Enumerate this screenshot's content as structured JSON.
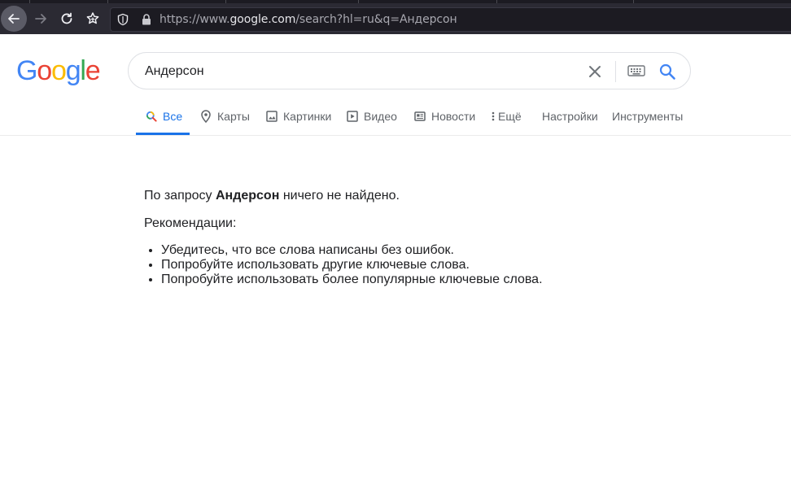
{
  "browser": {
    "url_prefix": "https://www.",
    "url_host": "google.com",
    "url_suffix": "/search?hl=ru&q=Андерсон"
  },
  "logo_text": [
    "G",
    "o",
    "o",
    "g",
    "l",
    "e"
  ],
  "logo_colors": [
    "#4285f4",
    "#ea4335",
    "#fbbc05",
    "#4285f4",
    "#34a853",
    "#ea4335"
  ],
  "search": {
    "value": "Андерсон"
  },
  "tabs": [
    {
      "label": "Все",
      "icon": "search-icon",
      "active": true
    },
    {
      "label": "Карты",
      "icon": "map-pin-icon"
    },
    {
      "label": "Картинки",
      "icon": "image-icon"
    },
    {
      "label": "Видео",
      "icon": "video-icon"
    },
    {
      "label": "Новости",
      "icon": "news-icon"
    },
    {
      "label": "Ещё",
      "icon": "more-vert-icon"
    },
    {
      "label": "Настройки"
    },
    {
      "label": "Инструменты"
    }
  ],
  "results": {
    "no_results_prefix": "По запросу ",
    "no_results_query": "Андерсон",
    "no_results_suffix": " ничего не найдено.",
    "recommendations_label": "Рекомендации:",
    "suggestions": [
      "Убедитесь, что все слова написаны без ошибок.",
      "Попробуйте использовать другие ключевые слова.",
      "Попробуйте использовать более популярные ключевые слова."
    ]
  },
  "colors": {
    "accent": "#1a73e8",
    "text": "#202124",
    "muted": "#5f6368"
  }
}
